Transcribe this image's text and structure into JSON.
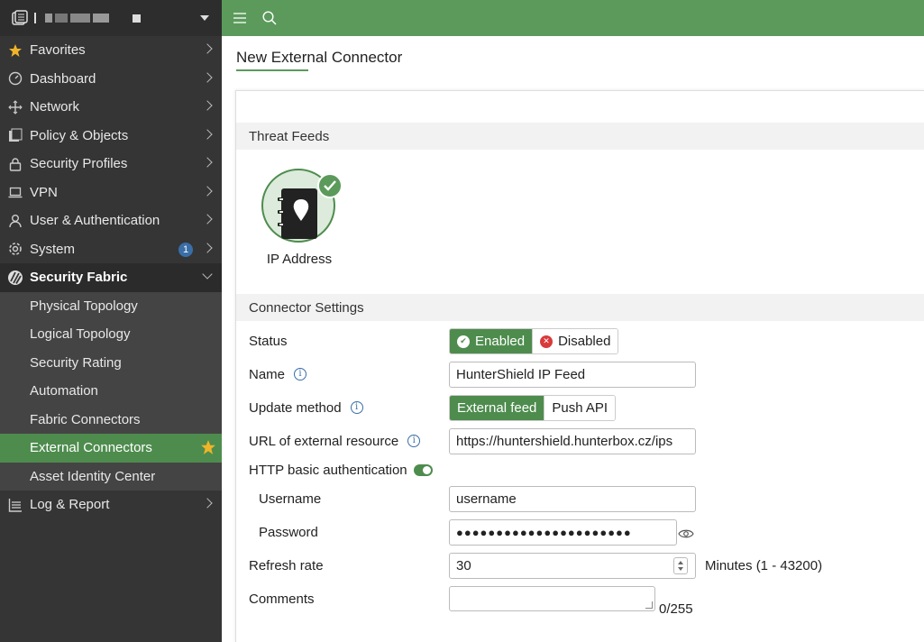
{
  "sidebar": {
    "items": [
      {
        "label": "Favorites",
        "icon": "star-icon"
      },
      {
        "label": "Dashboard",
        "icon": "dashboard-icon"
      },
      {
        "label": "Network",
        "icon": "network-icon"
      },
      {
        "label": "Policy & Objects",
        "icon": "policy-icon"
      },
      {
        "label": "Security Profiles",
        "icon": "lock-icon"
      },
      {
        "label": "VPN",
        "icon": "laptop-icon"
      },
      {
        "label": "User & Authentication",
        "icon": "user-icon"
      },
      {
        "label": "System",
        "icon": "gear-icon",
        "badge": "1"
      },
      {
        "label": "Security Fabric",
        "icon": "fabric-icon"
      }
    ],
    "fabric_sub": [
      {
        "label": "Physical Topology"
      },
      {
        "label": "Logical Topology"
      },
      {
        "label": "Security Rating"
      },
      {
        "label": "Automation"
      },
      {
        "label": "Fabric Connectors"
      },
      {
        "label": "External Connectors"
      },
      {
        "label": "Asset Identity Center"
      }
    ],
    "log": {
      "label": "Log & Report",
      "icon": "log-icon"
    }
  },
  "page": {
    "title": "New External Connector",
    "threat_feeds_heading": "Threat Feeds",
    "feed_label": "IP Address",
    "connector_settings_heading": "Connector Settings"
  },
  "form": {
    "status_label": "Status",
    "status_enabled": "Enabled",
    "status_disabled": "Disabled",
    "name_label": "Name",
    "name_value": "HunterShield IP Feed",
    "update_label": "Update method",
    "update_external": "External feed",
    "update_push": "Push API",
    "url_label": "URL of external resource",
    "url_value": "https://huntershield.hunterbox.cz/ips",
    "http_auth_label": "HTTP basic authentication",
    "username_label": "Username",
    "username_value": "username",
    "password_label": "Password",
    "password_value": "●●●●●●●●●●●●●●●●●●●●●●",
    "refresh_label": "Refresh rate",
    "refresh_value": "30",
    "refresh_unit": "Minutes (1 - 43200)",
    "comments_label": "Comments",
    "comments_counter": "0/255"
  },
  "colors": {
    "accent": "#5b9a5b",
    "sidebar": "#353535",
    "active": "#4e8c4e",
    "badge": "#3a6ea8"
  }
}
